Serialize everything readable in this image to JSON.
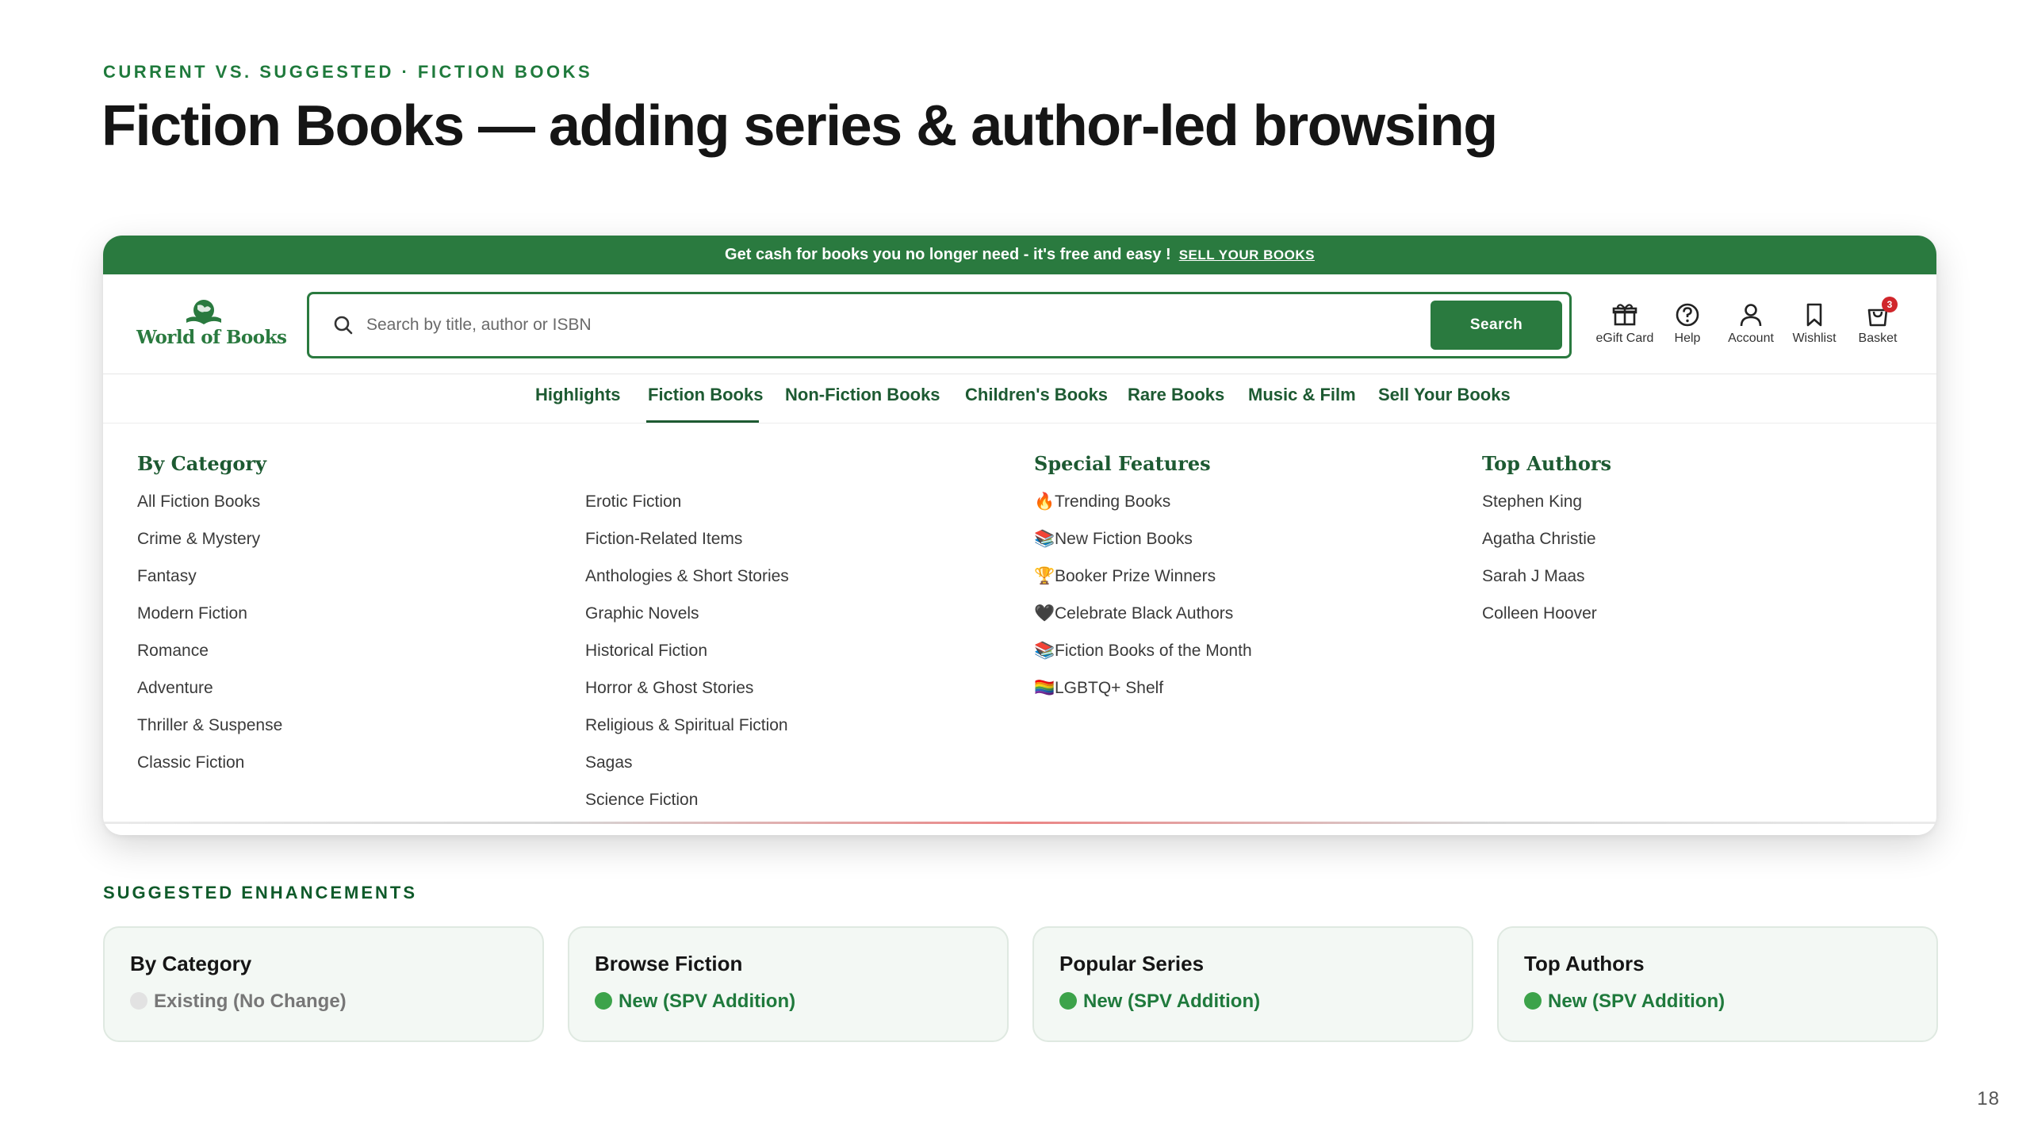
{
  "eyebrow": "CURRENT VS. SUGGESTED · FICTION BOOKS",
  "title": "Fiction Books — adding series & author-led browsing",
  "screenshot": {
    "promo": {
      "text": "Get cash for books you no longer need - it's free and easy !",
      "link": "SELL YOUR BOOKS"
    },
    "logo_text": "World of Books",
    "search": {
      "placeholder": "Search by title, author or ISBN",
      "button_label": "Search"
    },
    "utility": [
      {
        "label": "eGift Card",
        "icon": "gift-icon"
      },
      {
        "label": "Help",
        "icon": "help-icon"
      },
      {
        "label": "Account",
        "icon": "account-icon"
      },
      {
        "label": "Wishlist",
        "icon": "bookmark-icon"
      },
      {
        "label": "Basket",
        "icon": "basket-icon",
        "badge": "3"
      }
    ],
    "nav": [
      "Highlights",
      "Fiction Books",
      "Non-Fiction Books",
      "Children's Books",
      "Rare Books",
      "Music & Film",
      "Sell Your Books"
    ],
    "nav_active": "Fiction Books",
    "mega_menu": {
      "by_category": {
        "heading": "By Category",
        "col1": [
          "All Fiction Books",
          "Crime & Mystery",
          "Fantasy",
          "Modern Fiction",
          "Romance",
          "Adventure",
          "Thriller & Suspense",
          "Classic Fiction"
        ],
        "col2": [
          "Erotic Fiction",
          "Fiction-Related Items",
          "Anthologies & Short Stories",
          "Graphic Novels",
          "Historical Fiction",
          "Horror & Ghost Stories",
          "Religious & Spiritual Fiction",
          "Sagas",
          "Science Fiction"
        ]
      },
      "special_features": {
        "heading": "Special Features",
        "items": [
          {
            "emoji": "🔥",
            "label": "Trending Books"
          },
          {
            "emoji": "📚",
            "label": "New Fiction Books"
          },
          {
            "emoji": "🏆",
            "label": "Booker Prize Winners"
          },
          {
            "emoji": "🖤",
            "label": "Celebrate Black Authors"
          },
          {
            "emoji": "📚",
            "label": "Fiction Books of the Month"
          },
          {
            "emoji": "🏳️‍🌈",
            "label": "LGBTQ+ Shelf"
          }
        ]
      },
      "top_authors": {
        "heading": "Top Authors",
        "items": [
          "Stephen King",
          "Agatha Christie",
          "Sarah J Maas",
          "Colleen Hoover"
        ]
      }
    }
  },
  "enhancements": {
    "label": "SUGGESTED ENHANCEMENTS",
    "cards": [
      {
        "title": "By Category",
        "status": "Existing (No Change)",
        "kind": "existing"
      },
      {
        "title": "Browse Fiction",
        "status": "New (SPV Addition)",
        "kind": "new"
      },
      {
        "title": "Popular Series",
        "status": "New (SPV Addition)",
        "kind": "new"
      },
      {
        "title": "Top Authors",
        "status": "New (SPV Addition)",
        "kind": "new"
      }
    ]
  },
  "colors": {
    "brand_green": "#2a7a3f",
    "new_dot": "#3ca34a",
    "existing_dot": "#e2e2e2"
  },
  "page_number": "18"
}
